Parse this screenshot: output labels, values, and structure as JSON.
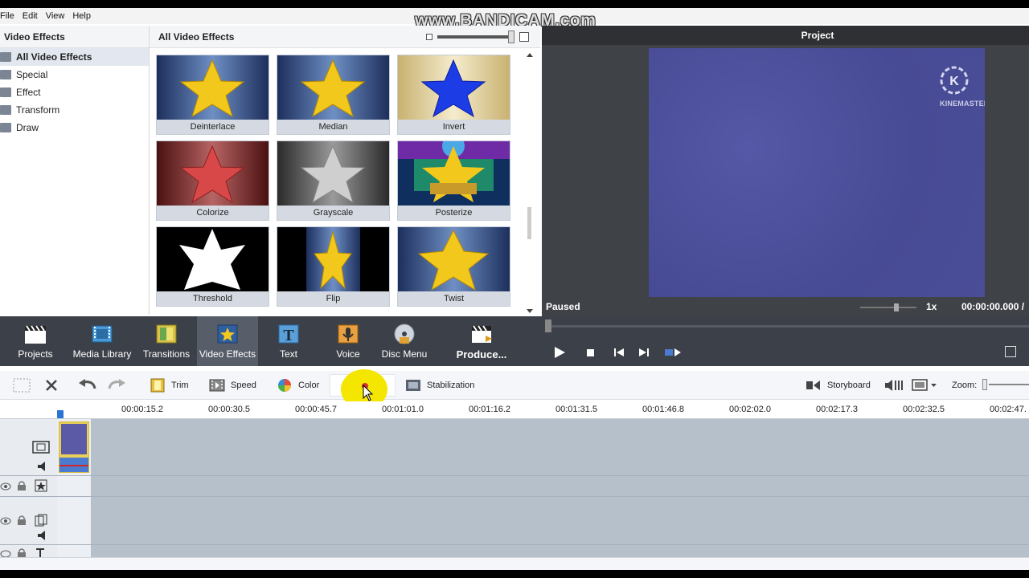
{
  "menu": [
    "File",
    "Edit",
    "View",
    "Help"
  ],
  "watermark": "www.BANDICAM.com",
  "categories": {
    "header": "Video Effects",
    "items": [
      "All Video Effects",
      "Special",
      "Effect",
      "Transform",
      "Draw"
    ],
    "selected": "All Video Effects"
  },
  "effects": {
    "header": "All Video Effects",
    "items": [
      "Deinterlace",
      "Median",
      "Invert",
      "Colorize",
      "Grayscale",
      "Posterize",
      "Threshold",
      "Flip",
      "Twist"
    ]
  },
  "preview": {
    "title": "Project",
    "logo_letter": "K",
    "logo_text": "KINEMASTER",
    "status": "Paused",
    "speed": "1x",
    "timecode": "00:00:00.000 /"
  },
  "toolbar": {
    "items": [
      "Projects",
      "Media Library",
      "Transitions",
      "Video Effects",
      "Text",
      "Voice",
      "Disc Menu",
      "Produce..."
    ],
    "active": "Video Effects"
  },
  "edit_toolbar": {
    "trim": "Trim",
    "speed": "Speed",
    "color": "Color",
    "stabilization": "Stabilization",
    "storyboard": "Storyboard",
    "zoom": "Zoom:"
  },
  "ruler": [
    "00:00:15.2",
    "00:00:30.5",
    "00:00:45.7",
    "00:01:01.0",
    "00:01:16.2",
    "00:01:31.5",
    "00:01:46.8",
    "00:02:02.0",
    "00:02:17.3",
    "00:02:32.5",
    "00:02:47."
  ],
  "colors": {
    "toolbar_bg": "#3c4048",
    "preview_bg": "#3f4247",
    "frame_color": "#4b4f9a",
    "track_bg": "#b6c0cb",
    "star_yellow": "#f2c81c"
  }
}
